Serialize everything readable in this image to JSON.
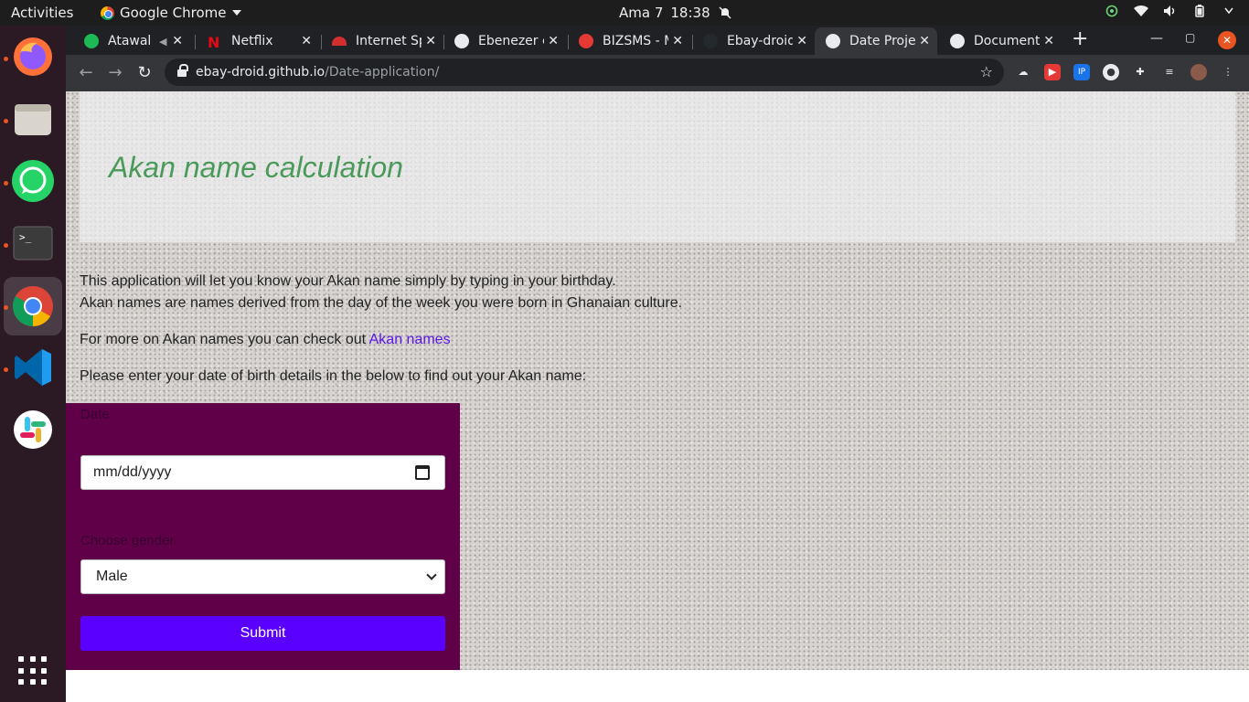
{
  "topbar": {
    "activities": "Activities",
    "app_name": "Google Chrome",
    "date": "Ama 7",
    "time": "18:38"
  },
  "dock": {
    "apps": [
      "firefox-icon",
      "files-icon",
      "whatsapp-icon",
      "terminal-icon",
      "chrome-icon",
      "vscode-icon",
      "slack-icon"
    ],
    "active_app": "chrome-icon"
  },
  "tabs": [
    {
      "title": "Atawal",
      "favicon": "spotify",
      "color": "#1db954"
    },
    {
      "title": "Netflix",
      "favicon": "netflix",
      "color": "#e50914"
    },
    {
      "title": "Internet Sp",
      "favicon": "speedtest",
      "color": "#d32f2f"
    },
    {
      "title": "Ebenezer c",
      "favicon": "globe",
      "color": "#e8eaed"
    },
    {
      "title": "BIZSMS - M",
      "favicon": "bizsms",
      "color": "#e53935"
    },
    {
      "title": "Ebay-droid",
      "favicon": "github",
      "color": "#24292e"
    },
    {
      "title": "Date Proje",
      "favicon": "globe",
      "color": "#e8eaed",
      "active": true
    },
    {
      "title": "Document",
      "favicon": "globe",
      "color": "#e8eaed"
    }
  ],
  "address": {
    "host": "ebay-droid.github.io",
    "path": "/Date-application/"
  },
  "page": {
    "title": "Akan name calculation",
    "intro_line1": "This application will let you know your Akan name simply by typing in your birthday.",
    "intro_line2": "Akan names are names derived from the day of the week you were born in Ghanaian culture.",
    "more_text": "For more on Akan names you can check out ",
    "more_link": "Akan names",
    "instruction": "Please enter your date of birth details in the below to find out your Akan name:"
  },
  "form": {
    "date_label": "Date",
    "date_placeholder": "mm/dd/yyyy",
    "gender_label": "Choose gender",
    "gender_selected": "Male",
    "submit_label": "Submit"
  },
  "colors": {
    "title_green": "#4a9a5a",
    "form_bg": "#5f0048",
    "submit_bg": "#5a00ff",
    "link": "#5a17e8"
  }
}
